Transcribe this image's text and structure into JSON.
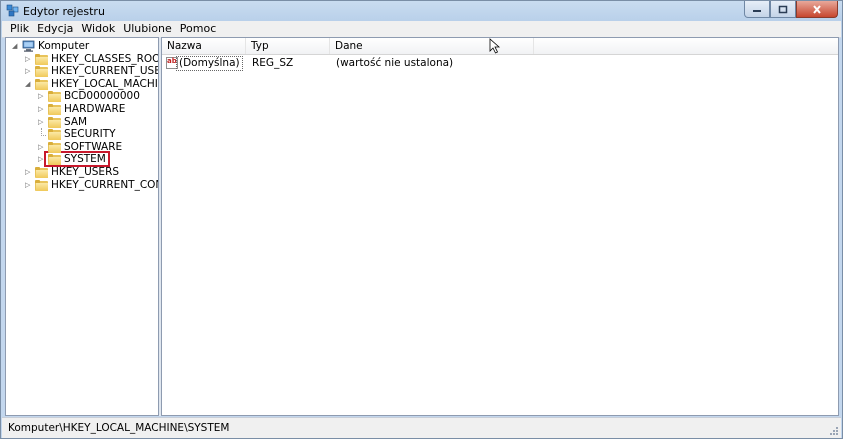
{
  "window": {
    "title": "Edytor rejestru"
  },
  "menu": [
    "Plik",
    "Edycja",
    "Widok",
    "Ulubione",
    "Pomoc"
  ],
  "tree": [
    {
      "label": "Komputer",
      "level": 0,
      "expander": "expanded",
      "icon": "computer-icon"
    },
    {
      "label": "HKEY_CLASSES_ROOT",
      "level": 1,
      "expander": "collapsed",
      "icon": "folder-icon"
    },
    {
      "label": "HKEY_CURRENT_USER",
      "level": 1,
      "expander": "collapsed",
      "icon": "folder-icon"
    },
    {
      "label": "HKEY_LOCAL_MACHINE",
      "level": 1,
      "expander": "expanded",
      "icon": "folder-icon"
    },
    {
      "label": "BCD00000000",
      "level": 2,
      "expander": "collapsed",
      "icon": "folder-icon"
    },
    {
      "label": "HARDWARE",
      "level": 2,
      "expander": "collapsed",
      "icon": "folder-icon"
    },
    {
      "label": "SAM",
      "level": 2,
      "expander": "collapsed",
      "icon": "folder-icon"
    },
    {
      "label": "SECURITY",
      "level": 2,
      "expander": "none",
      "icon": "folder-icon"
    },
    {
      "label": "SOFTWARE",
      "level": 2,
      "expander": "collapsed",
      "icon": "folder-icon"
    },
    {
      "label": "SYSTEM",
      "level": 2,
      "expander": "collapsed",
      "icon": "folder-icon",
      "highlighted": true
    },
    {
      "label": "HKEY_USERS",
      "level": 1,
      "expander": "collapsed",
      "icon": "folder-icon"
    },
    {
      "label": "HKEY_CURRENT_CONFIG",
      "level": 1,
      "expander": "collapsed",
      "icon": "folder-icon"
    }
  ],
  "list": {
    "columns": [
      "Nazwa",
      "Typ",
      "Dane"
    ],
    "rows": [
      {
        "name": "(Domyślna)",
        "type": "REG_SZ",
        "data": "(wartość nie ustalona)",
        "icon": "string-value-icon",
        "icon_text": "ab"
      }
    ]
  },
  "status": {
    "path": "Komputer\\HKEY_LOCAL_MACHINE\\SYSTEM"
  },
  "colors": {
    "highlight_border": "#c8182c",
    "folder": "#f0c95a"
  }
}
